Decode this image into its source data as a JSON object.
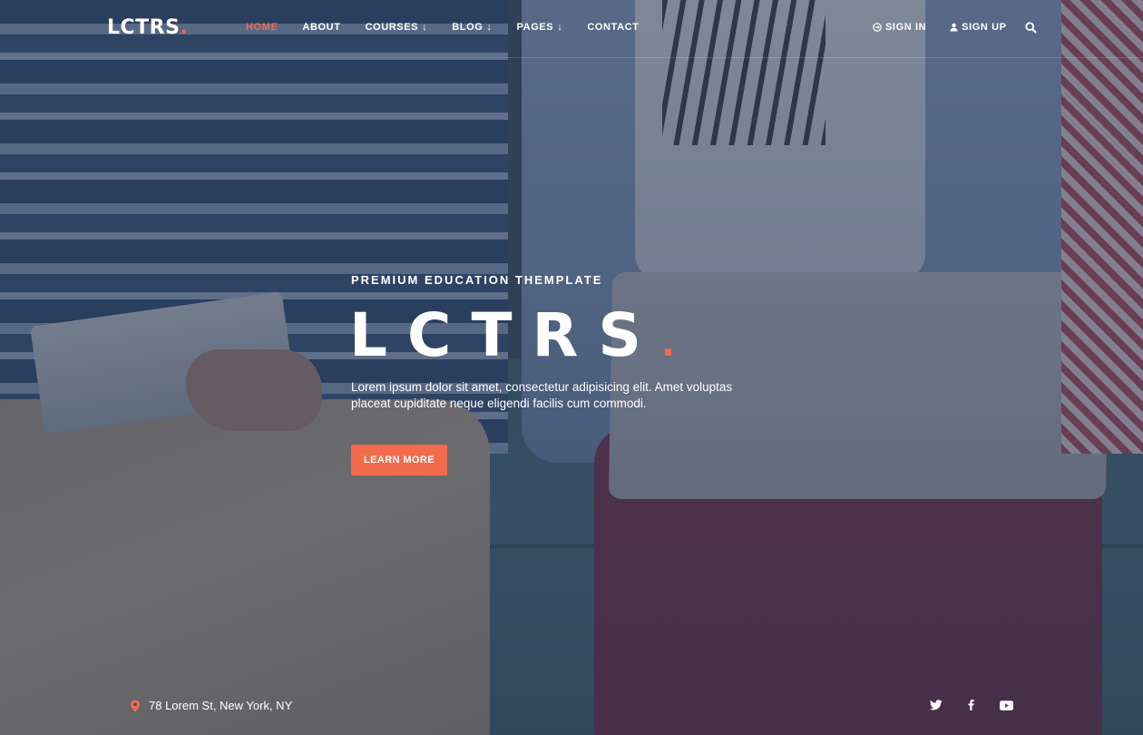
{
  "brand": {
    "logo_text": "LCTRS",
    "logo_dot": "."
  },
  "nav": {
    "items": [
      {
        "label": "HOME",
        "active": true
      },
      {
        "label": "ABOUT"
      },
      {
        "label": "COURSES",
        "has_dropdown": true
      },
      {
        "label": "BLOG",
        "has_dropdown": true
      },
      {
        "label": "PAGES",
        "has_dropdown": true
      },
      {
        "label": "CONTACT"
      }
    ],
    "dropdown_icon": "arrow-down-icon"
  },
  "auth": {
    "sign_in": {
      "label": "SIGN IN",
      "icon": "sign-in-icon"
    },
    "sign_up": {
      "label": "SIGN UP",
      "icon": "user-icon"
    }
  },
  "search": {
    "icon": "search-icon"
  },
  "hero": {
    "eyebrow": "PREMIUM EDUCATION THEMPLATE",
    "title": "LCTRS",
    "title_dot": ".",
    "description": "Lorem ipsum dolor sit amet, consectetur adipisicing elit. Amet voluptas placeat cupiditate neque eligendi facilis cum commodi.",
    "cta_label": "LEARN MORE"
  },
  "footer": {
    "address": "78 Lorem St, New York, NY",
    "address_icon": "map-pin-icon",
    "social": [
      "twitter-icon",
      "facebook-icon",
      "youtube-icon"
    ]
  },
  "colors": {
    "accent": "#f36b4d",
    "overlay": "#263450",
    "text": "#ffffff"
  }
}
